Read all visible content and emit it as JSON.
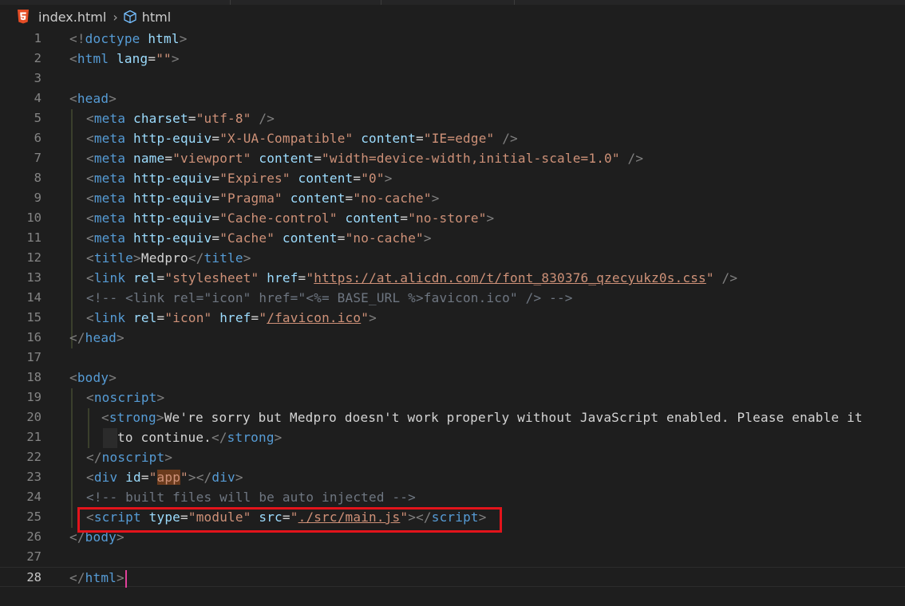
{
  "breadcrumb": {
    "file": "index.html",
    "symbol": "html"
  },
  "editor": {
    "current_line": 28,
    "lines": [
      {
        "n": "1"
      },
      {
        "n": "2"
      },
      {
        "n": "3"
      },
      {
        "n": "4"
      },
      {
        "n": "5"
      },
      {
        "n": "6"
      },
      {
        "n": "7"
      },
      {
        "n": "8"
      },
      {
        "n": "9"
      },
      {
        "n": "10"
      },
      {
        "n": "11"
      },
      {
        "n": "12"
      },
      {
        "n": "13"
      },
      {
        "n": "14"
      },
      {
        "n": "15"
      },
      {
        "n": "16"
      },
      {
        "n": "17"
      },
      {
        "n": "18"
      },
      {
        "n": "19"
      },
      {
        "n": "20"
      },
      {
        "n": "21"
      },
      {
        "n": "22"
      },
      {
        "n": "23"
      },
      {
        "n": "24"
      },
      {
        "n": "25"
      },
      {
        "n": "26"
      },
      {
        "n": "27"
      },
      {
        "n": "28"
      }
    ],
    "code": {
      "l1": [
        "<!",
        "doctype",
        " html",
        ">"
      ],
      "l2": [
        "<",
        "html",
        " lang",
        "=",
        "\"\"",
        ">"
      ],
      "l4": [
        "<",
        "head",
        ">"
      ],
      "l5": [
        "<",
        "meta",
        " charset",
        "=",
        "\"utf-8\"",
        " />"
      ],
      "l6": [
        "<",
        "meta",
        " http-equiv",
        "=",
        "\"X-UA-Compatible\"",
        " content",
        "=",
        "\"IE=edge\"",
        " />"
      ],
      "l7": [
        "<",
        "meta",
        " name",
        "=",
        "\"viewport\"",
        " content",
        "=",
        "\"width=device-width,initial-scale=1.0\"",
        " />"
      ],
      "l8": [
        "<",
        "meta",
        " http-equiv",
        "=",
        "\"Expires\"",
        " content",
        "=",
        "\"0\"",
        ">"
      ],
      "l9": [
        "<",
        "meta",
        " http-equiv",
        "=",
        "\"Pragma\"",
        " content",
        "=",
        "\"no-cache\"",
        ">"
      ],
      "l10": [
        "<",
        "meta",
        " http-equiv",
        "=",
        "\"Cache-control\"",
        " content",
        "=",
        "\"no-store\"",
        ">"
      ],
      "l11": [
        "<",
        "meta",
        " http-equiv",
        "=",
        "\"Cache\"",
        " content",
        "=",
        "\"no-cache\"",
        ">"
      ],
      "l12": [
        "<",
        "title",
        ">",
        "Medpro",
        "</",
        "title",
        ">"
      ],
      "l13": [
        "<",
        "link",
        " rel",
        "=",
        "\"stylesheet\"",
        " href",
        "=",
        "\"",
        "https://at.alicdn.com/t/font_830376_qzecyukz0s.css",
        "\"",
        " />"
      ],
      "l14": "<!-- <link rel=\"icon\" href=\"<%= BASE_URL %>favicon.ico\" /> -->",
      "l15": [
        "<",
        "link",
        " rel",
        "=",
        "\"icon\"",
        " href",
        "=",
        "\"",
        "/favicon.ico",
        "\"",
        ">"
      ],
      "l16": [
        "</",
        "head",
        ">"
      ],
      "l18": [
        "<",
        "body",
        ">"
      ],
      "l19": [
        "<",
        "noscript",
        ">"
      ],
      "l20": [
        "<",
        "strong",
        ">",
        "We're sorry but Medpro doesn't work properly without JavaScript enabled. Please enable it"
      ],
      "l21": [
        "to continue.",
        "</",
        "strong",
        ">"
      ],
      "l22": [
        "</",
        "noscript",
        ">"
      ],
      "l23": [
        "<",
        "div",
        " id",
        "=",
        "\"",
        "app",
        "\"",
        "></",
        "div",
        ">"
      ],
      "l24": "<!-- built files will be auto injected -->",
      "l25": [
        "<",
        "script",
        " type",
        "=",
        "\"module\"",
        " src",
        "=",
        "\"",
        "./src/main.js",
        "\"",
        "></",
        "script",
        ">"
      ],
      "l26": [
        "</",
        "body",
        ">"
      ],
      "l28": [
        "</",
        "html",
        ">"
      ]
    }
  },
  "colors": {
    "background": "#1e1e1e",
    "tag": "#569cd6",
    "attribute": "#9cdcfe",
    "string": "#ce9178",
    "punctuation": "#808080",
    "comment": "#6e7681",
    "highlight_box": "#e3141b"
  },
  "icons": {
    "file_icon": "html5-icon",
    "symbol_icon": "cube-icon"
  }
}
